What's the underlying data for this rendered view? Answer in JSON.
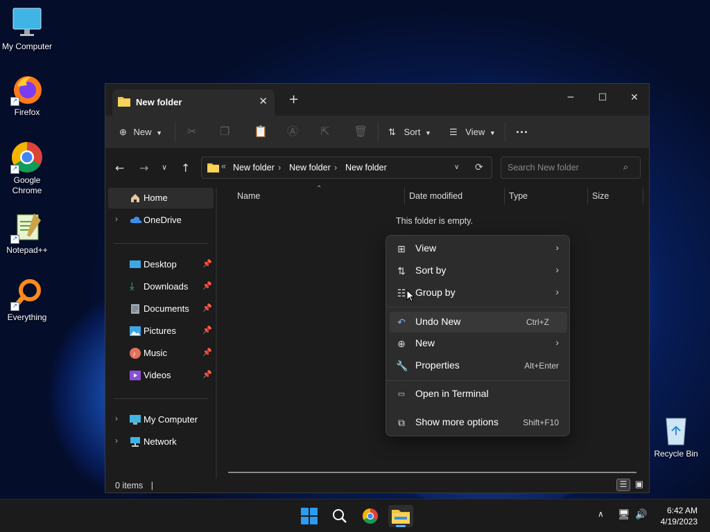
{
  "desktop": {
    "icons": [
      {
        "label": "My Computer",
        "icon": "monitor-icon"
      },
      {
        "label": "Firefox",
        "icon": "firefox-icon"
      },
      {
        "label": "Google Chrome",
        "icon": "chrome-icon"
      },
      {
        "label": "Notepad++",
        "icon": "notepadpp-icon"
      },
      {
        "label": "Everything",
        "icon": "everything-search-icon"
      },
      {
        "label": "Recycle Bin",
        "icon": "recycle-bin-icon"
      }
    ]
  },
  "window": {
    "tab_title": "New folder",
    "toolbar": {
      "new_label": "New",
      "sort_label": "Sort",
      "view_label": "View",
      "disabled_actions": [
        "cut-icon",
        "copy-icon",
        "paste-icon",
        "rename-icon",
        "share-icon",
        "delete-icon"
      ]
    },
    "address": {
      "overflow": "«",
      "crumbs": [
        "New folder",
        "New folder",
        "New folder"
      ],
      "search_placeholder": "Search New folder"
    },
    "sidebar": {
      "home": "Home",
      "onedrive": "OneDrive",
      "pinned": [
        "Desktop",
        "Downloads",
        "Documents",
        "Pictures",
        "Music",
        "Videos"
      ],
      "my_computer": "My Computer",
      "network": "Network"
    },
    "columns": {
      "name": "Name",
      "date": "Date modified",
      "type": "Type",
      "size": "Size"
    },
    "empty_message": "This folder is empty.",
    "status": "0 items"
  },
  "context_menu": {
    "items": [
      {
        "label": "View",
        "icon": "grid-icon",
        "submenu": true
      },
      {
        "label": "Sort by",
        "icon": "sort-icon",
        "submenu": true
      },
      {
        "label": "Group by",
        "icon": "group-icon",
        "submenu": true
      },
      {
        "label": "Undo New",
        "icon": "undo-icon",
        "shortcut": "Ctrl+Z"
      },
      {
        "label": "New",
        "icon": "plus-circle-icon",
        "submenu": true
      },
      {
        "label": "Properties",
        "icon": "wrench-icon",
        "shortcut": "Alt+Enter"
      },
      {
        "label": "Open in Terminal",
        "icon": "terminal-icon"
      },
      {
        "label": "Show more options",
        "icon": "more-options-icon",
        "shortcut": "Shift+F10"
      }
    ]
  },
  "taskbar": {
    "clock_time": "6:42 AM",
    "clock_date": "4/19/2023"
  },
  "colors": {
    "accent": "#0a64d2",
    "window_bg": "#1c1c1c",
    "menu_bg": "#2c2c2c",
    "folder": "#f3c445"
  }
}
